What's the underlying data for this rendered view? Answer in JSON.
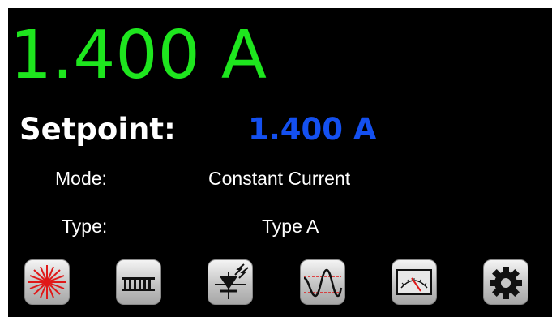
{
  "display": {
    "reading": "1.400 A",
    "setpoint_label": "Setpoint:",
    "setpoint_value": "1.400 A",
    "mode_label": "Mode:",
    "mode_value": "Constant Current",
    "type_label": "Type:",
    "type_value": "Type A"
  },
  "toolbar": {
    "buttons": [
      {
        "name": "laser-button",
        "icon": "laser-icon"
      },
      {
        "name": "strip-button",
        "icon": "strip-icon"
      },
      {
        "name": "photodiode-button",
        "icon": "photodiode-icon"
      },
      {
        "name": "waveform-button",
        "icon": "waveform-icon"
      },
      {
        "name": "meter-button",
        "icon": "meter-icon"
      },
      {
        "name": "settings-button",
        "icon": "gear-icon"
      }
    ]
  },
  "colors": {
    "reading": "#1ee61e",
    "setpoint_value": "#1450f0",
    "text": "#ffffff",
    "background": "#000000",
    "laser": "#e01818"
  }
}
